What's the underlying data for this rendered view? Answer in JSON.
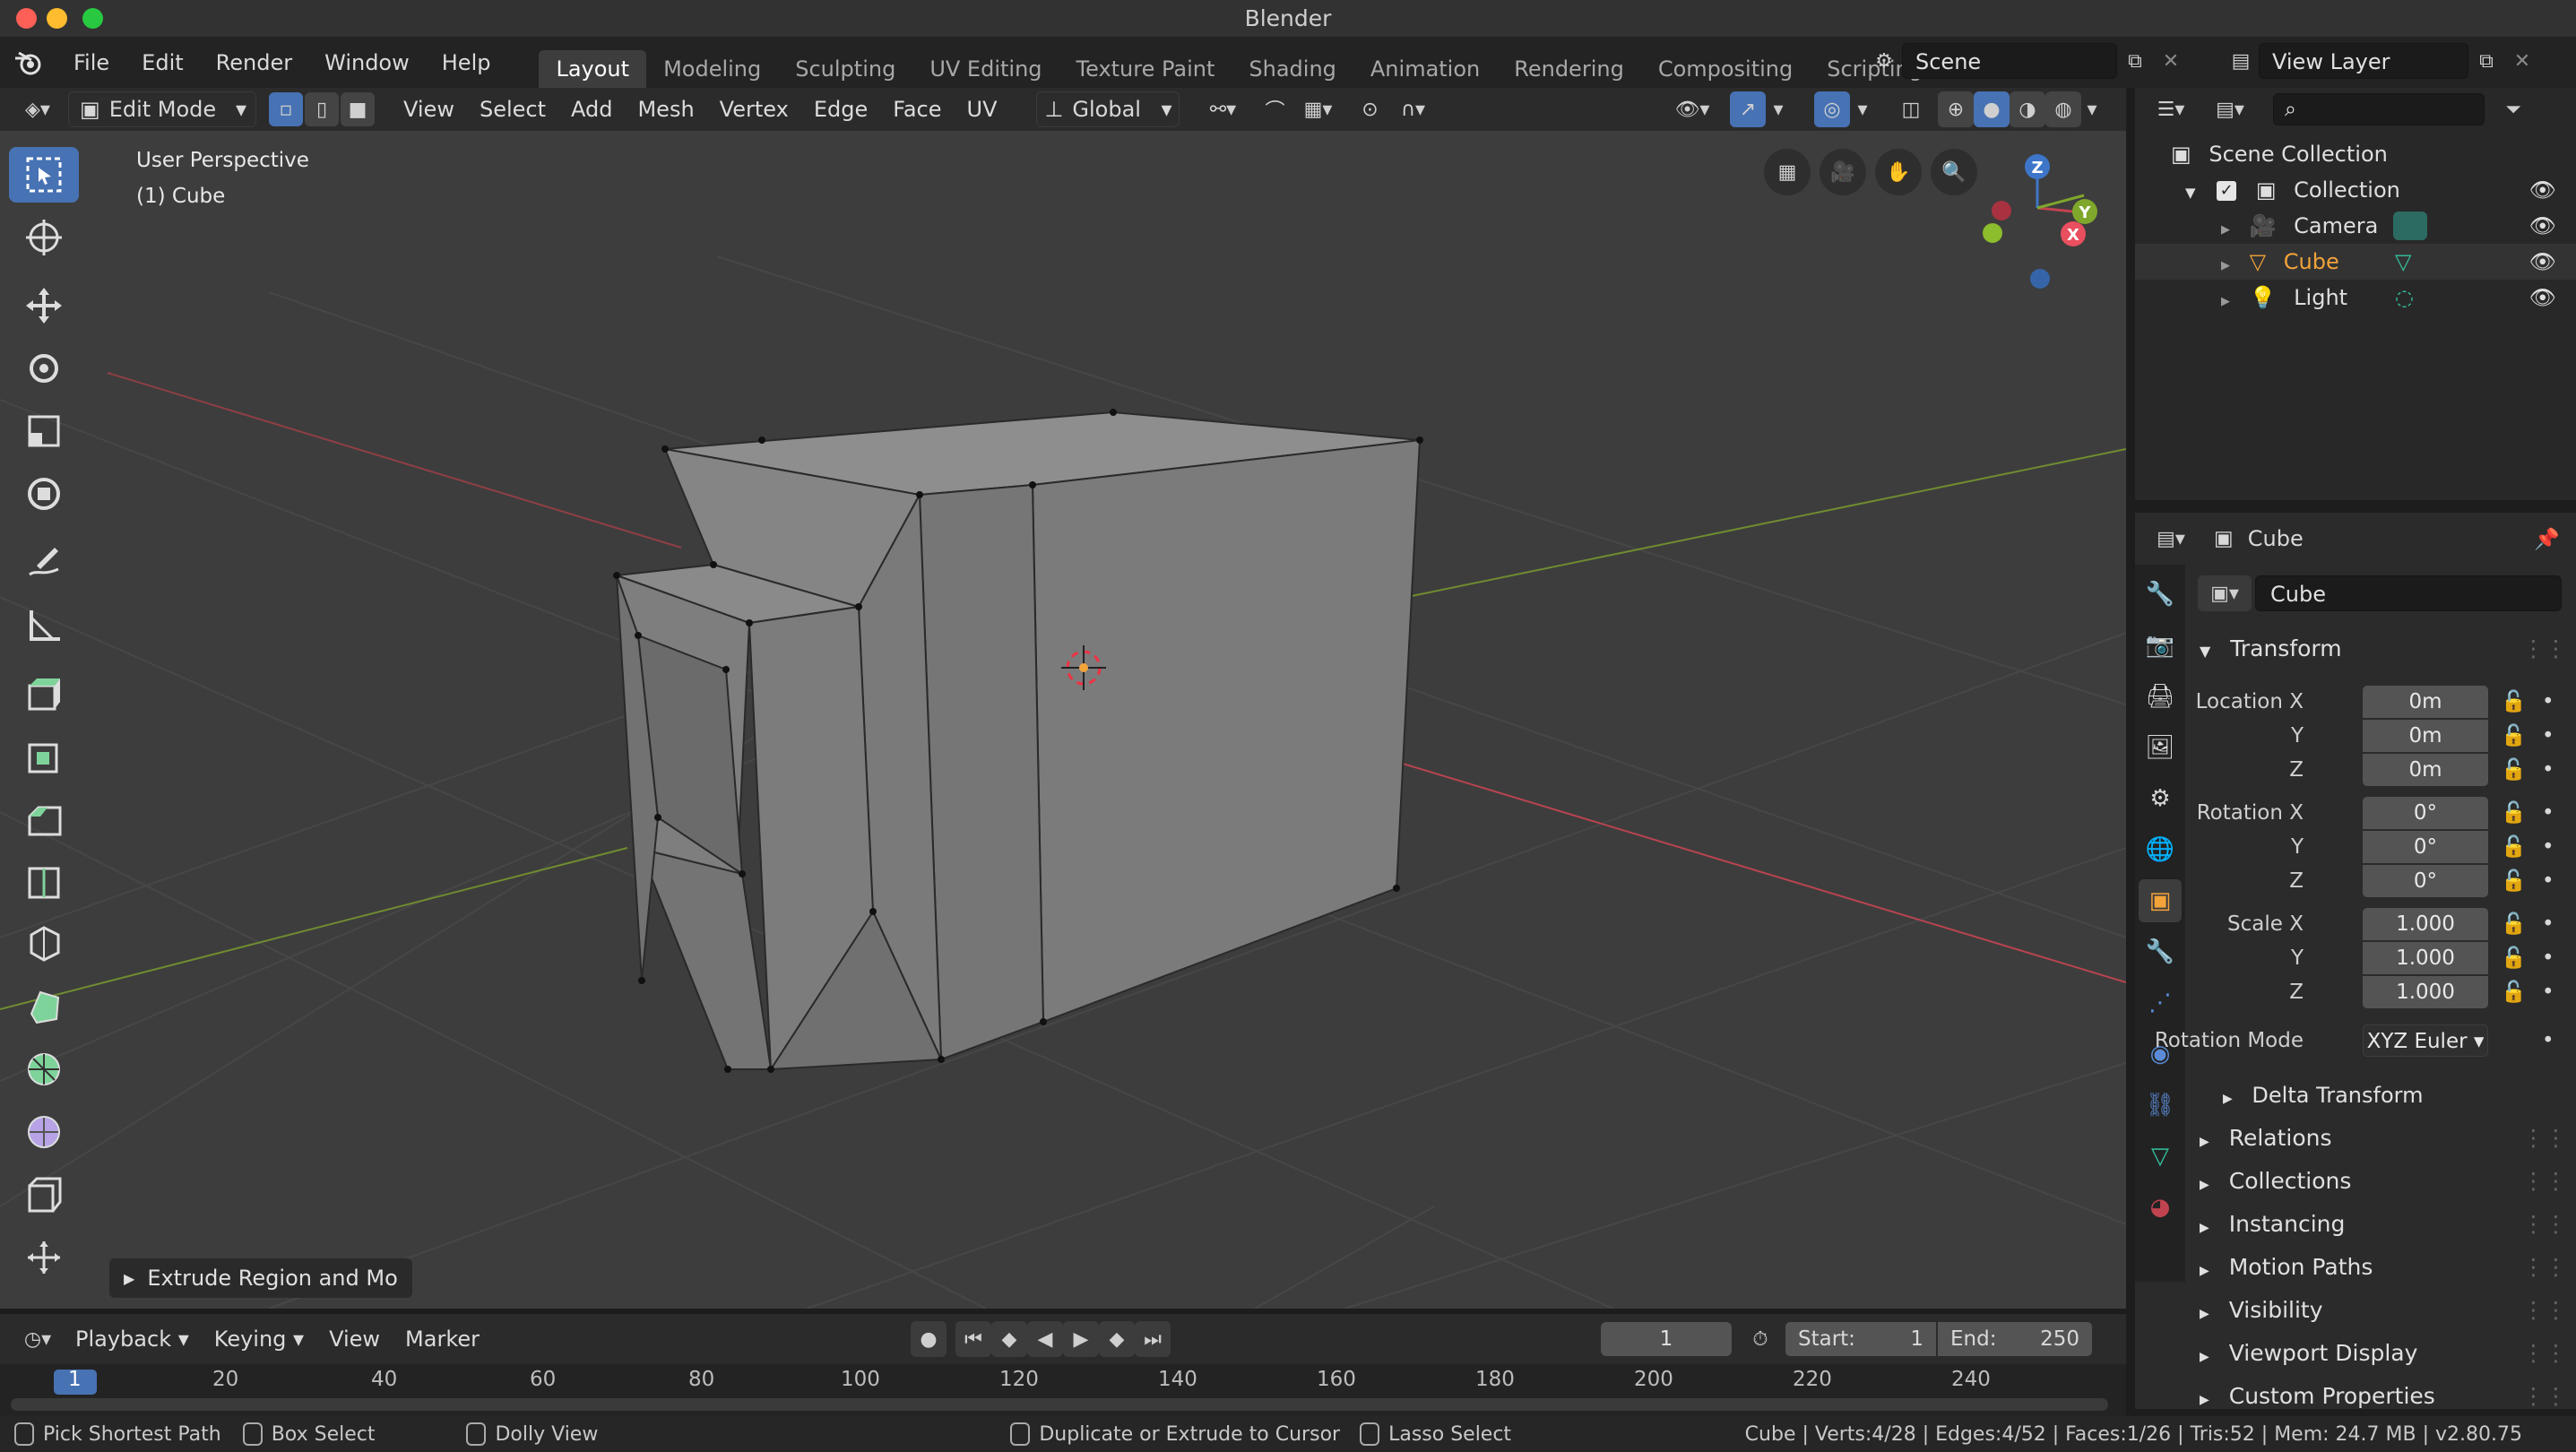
{
  "window": {
    "title": "Blender"
  },
  "menu": {
    "items": [
      "File",
      "Edit",
      "Render",
      "Window",
      "Help"
    ]
  },
  "workspaces": {
    "tabs": [
      "Layout",
      "Modeling",
      "Sculpting",
      "UV Editing",
      "Texture Paint",
      "Shading",
      "Animation",
      "Rendering",
      "Compositing",
      "Scripting"
    ],
    "active": "Layout",
    "add_label": "+"
  },
  "scene": {
    "name": "Scene",
    "view_layer": "View Layer"
  },
  "viewport_header": {
    "mode": "Edit Mode",
    "menus": [
      "View",
      "Select",
      "Add",
      "Mesh",
      "Vertex",
      "Edge",
      "Face",
      "UV"
    ],
    "orientation": "Global"
  },
  "viewport": {
    "perspective": "User Perspective",
    "object": "(1) Cube",
    "operator_panel": "Extrude Region and Mo",
    "gizmo": {
      "x": "X",
      "y": "Y",
      "z": "Z"
    }
  },
  "outliner": {
    "root": "Scene Collection",
    "collection": "Collection",
    "items": [
      {
        "name": "Camera",
        "color": "#dedede"
      },
      {
        "name": "Cube",
        "color": "#f2a33a"
      },
      {
        "name": "Light",
        "color": "#dedede"
      }
    ]
  },
  "properties": {
    "object_name": "Cube",
    "object_field": "Cube",
    "transform_title": "Transform",
    "location": {
      "label": "Location X",
      "x": "0m",
      "y": "0m",
      "z": "0m"
    },
    "rotation": {
      "label": "Rotation X",
      "x": "0°",
      "y": "0°",
      "z": "0°"
    },
    "scale": {
      "label": "Scale X",
      "x": "1.000",
      "y": "1.000",
      "z": "1.000"
    },
    "axis_y": "Y",
    "axis_z": "Z",
    "rotation_mode_label": "Rotation Mode",
    "rotation_mode": "XYZ Euler",
    "delta_transform": "Delta Transform",
    "sections": [
      "Relations",
      "Collections",
      "Instancing",
      "Motion Paths",
      "Visibility",
      "Viewport Display",
      "Custom Properties"
    ]
  },
  "timeline": {
    "menus": [
      "Playback",
      "Keying",
      "View",
      "Marker"
    ],
    "current_frame": "1",
    "start_label": "Start:",
    "start": "1",
    "end_label": "End:",
    "end": "250",
    "ticks": [
      "1",
      "20",
      "40",
      "60",
      "80",
      "100",
      "120",
      "140",
      "160",
      "180",
      "200",
      "220",
      "240"
    ]
  },
  "statusbar": {
    "hints": [
      "Pick Shortest Path",
      "Box Select",
      "Dolly View",
      "Duplicate or Extrude to Cursor",
      "Lasso Select"
    ],
    "stats": "Cube | Verts:4/28 | Edges:4/52 | Faces:1/26 | Tris:52 | Mem: 24.7 MB | v2.80.75"
  },
  "colors": {
    "accent": "#4772b3",
    "selected_object": "#f2a33a",
    "x_axis": "#c1434f",
    "y_axis": "#7fa72c",
    "z_axis": "#3d76c9"
  }
}
